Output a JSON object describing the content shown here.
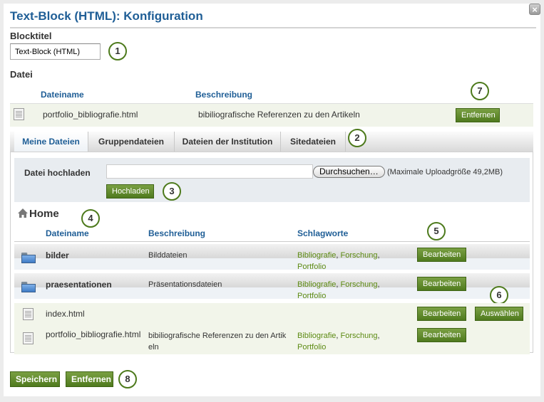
{
  "dialog": {
    "title": "Text-Block (HTML): Konfiguration",
    "close_icon": "close-icon"
  },
  "block_title": {
    "label": "Blocktitel",
    "value": "Text-Block (HTML)"
  },
  "selected_file": {
    "section_label": "Datei",
    "headers": {
      "filename": "Dateiname",
      "description": "Beschreibung"
    },
    "row": {
      "icon": "file-icon",
      "filename": "portfolio_bibliografie.html",
      "description": "bibiliografische Referenzen zu den Artikeln",
      "remove_label": "Entfernen"
    }
  },
  "tabs": [
    {
      "label": "Meine Dateien",
      "active": true
    },
    {
      "label": "Gruppendateien",
      "active": false
    },
    {
      "label": "Dateien der Institution",
      "active": false
    },
    {
      "label": "Sitedateien",
      "active": false
    }
  ],
  "upload": {
    "label": "Datei hochladen",
    "file_value": "",
    "browse_label": "Durchsuchen…",
    "max_size_note": "(Maximale Uploadgröße 49,2MB)",
    "upload_label": "Hochladen"
  },
  "browser": {
    "heading": "Home",
    "home_icon": "house-icon",
    "headers": {
      "filename": "Dateiname",
      "description": "Beschreibung",
      "tags": "Schlagworte"
    },
    "rows": [
      {
        "type": "folder",
        "name": "bilder",
        "description": "Bilddateien",
        "tags": [
          "Bibliografie",
          "Forschung",
          "Portfolio"
        ],
        "edit_label": "Bearbeiten",
        "select_label": ""
      },
      {
        "type": "folder",
        "name": "praesentationen",
        "description": "Präsentationsdateien",
        "tags": [
          "Bibliografie",
          "Forschung",
          "Portfolio"
        ],
        "edit_label": "Bearbeiten",
        "select_label": ""
      },
      {
        "type": "file",
        "name": "index.html",
        "description": "",
        "tags": [],
        "edit_label": "Bearbeiten",
        "select_label": "Auswählen"
      },
      {
        "type": "file",
        "name": "portfolio_bibliografie.html",
        "description_line1": "bibiliografische Referenzen zu den Artik",
        "description_line2": "eln",
        "tags": [
          "Bibliografie",
          "Forschung",
          "Portfolio"
        ],
        "edit_label": "Bearbeiten",
        "select_label": ""
      }
    ]
  },
  "footer": {
    "save_label": "Speichern",
    "remove_label": "Entfernen"
  },
  "callouts": [
    "1",
    "2",
    "3",
    "4",
    "5",
    "6",
    "7",
    "8"
  ],
  "colors": {
    "title_blue": "#1f5e96",
    "link_green": "#5c8a12",
    "button_green": "#5f8a2a",
    "callout_border": "#4d7a1c"
  }
}
